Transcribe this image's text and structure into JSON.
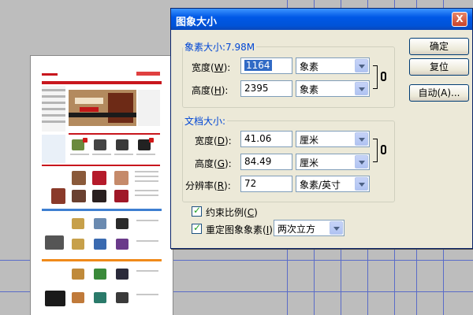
{
  "dialog": {
    "title": "图象大小",
    "close_label": "X",
    "pixel_group": {
      "legend": "象素大小:7.98M",
      "width_label_pre": "宽度(",
      "width_label_key": "W",
      "width_label_post": "):",
      "width_value": "1164",
      "width_unit": "象素",
      "height_label_pre": "高度(",
      "height_label_key": "H",
      "height_label_post": "):",
      "height_value": "2395",
      "height_unit": "象素"
    },
    "doc_group": {
      "legend": "文档大小:",
      "width_label_pre": "宽度(",
      "width_label_key": "D",
      "width_label_post": "):",
      "width_value": "41.06",
      "width_unit": "厘米",
      "height_label_pre": "高度(",
      "height_label_key": "G",
      "height_label_post": "):",
      "height_value": "84.49",
      "height_unit": "厘米",
      "res_label_pre": "分辨率(",
      "res_label_key": "R",
      "res_label_post": "):",
      "res_value": "72",
      "res_unit": "象素/英寸"
    },
    "constrain": {
      "label_pre": "约束比例(",
      "label_key": "C",
      "label_post": ")",
      "checked": true
    },
    "resample": {
      "label_pre": "重定图象象素(",
      "label_key": "I",
      "label_post": "):",
      "checked": true,
      "method": "两次立方"
    },
    "buttons": {
      "ok": "确定",
      "reset": "复位",
      "auto": "自动(A)..."
    }
  },
  "colors": {
    "titlebar": "#0058e6",
    "dialog_bg": "#ece9d8",
    "legend_text": "#0046d5",
    "selection": "#316ac5",
    "guide_line": "#5a6cc8"
  },
  "icons": {
    "link": "chain-link-icon",
    "close": "close-icon",
    "dropdown": "chevron-down-icon"
  }
}
